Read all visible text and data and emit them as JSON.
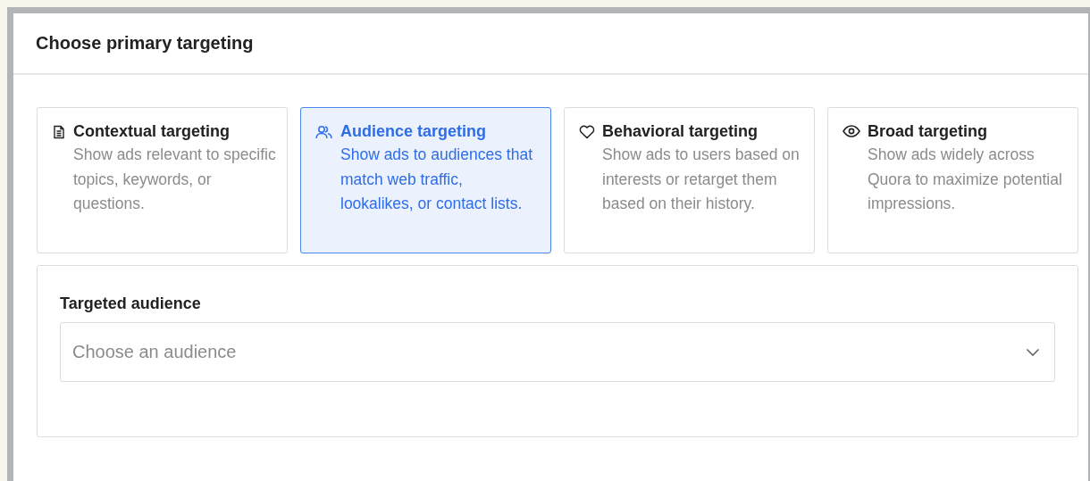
{
  "panel": {
    "title": "Choose primary targeting"
  },
  "options": [
    {
      "kind": "document",
      "title": "Contextual targeting",
      "description": "Show ads relevant to specific topics, keywords, or questions.",
      "selected": false
    },
    {
      "kind": "people",
      "title": "Audience targeting",
      "description": "Show ads to audiences that match web traffic, lookalikes, or contact lists.",
      "selected": true
    },
    {
      "kind": "heart",
      "title": "Behavioral targeting",
      "description": "Show ads to users based on interests or retarget them based on their history.",
      "selected": false
    },
    {
      "kind": "eye",
      "title": "Broad targeting",
      "description": "Show ads widely across Quora to maximize potential impressions.",
      "selected": false
    }
  ],
  "audience": {
    "label": "Targeted audience",
    "placeholder": "Choose an audience"
  }
}
